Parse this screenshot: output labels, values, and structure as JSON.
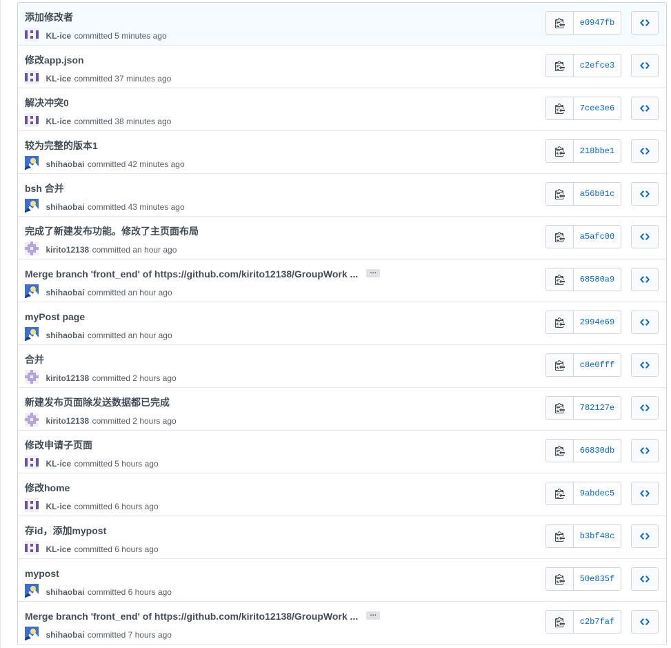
{
  "colors": {
    "link": "#0366d6",
    "text": "#444d56",
    "muted": "#586069",
    "border": "#d1d5da",
    "highlight": "#f6fbff"
  },
  "commits": [
    {
      "message": "添加修改者",
      "author": "KL-ice",
      "time": "committed 5 minutes ago",
      "sha": "e0947fb",
      "avatar": "kl-ice-avatar",
      "truncated": false
    },
    {
      "message": "修改app.json",
      "author": "KL-ice",
      "time": "committed 37 minutes ago",
      "sha": "c2efce3",
      "avatar": "kl-ice-avatar",
      "truncated": false
    },
    {
      "message": "解决冲突0",
      "author": "KL-ice",
      "time": "committed 38 minutes ago",
      "sha": "7cee3e6",
      "avatar": "kl-ice-avatar",
      "truncated": false
    },
    {
      "message": "较为完整的版本1",
      "author": "shihaobai",
      "time": "committed 42 minutes ago",
      "sha": "218bbe1",
      "avatar": "shihaobai-avatar",
      "truncated": false
    },
    {
      "message": "bsh 合并",
      "author": "shihaobai",
      "time": "committed 43 minutes ago",
      "sha": "a56b01c",
      "avatar": "shihaobai-avatar",
      "truncated": false
    },
    {
      "message": "完成了新建发布功能。修改了主页面布局",
      "author": "kirito12138",
      "time": "committed an hour ago",
      "sha": "a5afc00",
      "avatar": "kirito-avatar",
      "truncated": false
    },
    {
      "message": "Merge branch 'front_end' of https://github.com/kirito12138/GroupWork ...",
      "author": "shihaobai",
      "time": "committed an hour ago",
      "sha": "68580a9",
      "avatar": "shihaobai-avatar",
      "truncated": true
    },
    {
      "message": "myPost page",
      "author": "shihaobai",
      "time": "committed an hour ago",
      "sha": "2994e69",
      "avatar": "shihaobai-avatar",
      "truncated": false
    },
    {
      "message": "合并",
      "author": "kirito12138",
      "time": "committed 2 hours ago",
      "sha": "c8e0fff",
      "avatar": "kirito-avatar",
      "truncated": false
    },
    {
      "message": "新建发布页面除发送数据都已完成",
      "author": "kirito12138",
      "time": "committed 2 hours ago",
      "sha": "782127e",
      "avatar": "kirito-avatar",
      "truncated": false
    },
    {
      "message": "修改申请子页面",
      "author": "KL-ice",
      "time": "committed 5 hours ago",
      "sha": "66830db",
      "avatar": "kl-ice-avatar",
      "truncated": false
    },
    {
      "message": "修改home",
      "author": "KL-ice",
      "time": "committed 6 hours ago",
      "sha": "9abdec5",
      "avatar": "kl-ice-avatar",
      "truncated": false
    },
    {
      "message": "存id，添加mypost",
      "author": "KL-ice",
      "time": "committed 6 hours ago",
      "sha": "b3bf48c",
      "avatar": "kl-ice-avatar",
      "truncated": false
    },
    {
      "message": "mypost",
      "author": "shihaobai",
      "time": "committed 6 hours ago",
      "sha": "50e835f",
      "avatar": "shihaobai-avatar",
      "truncated": false
    },
    {
      "message": "Merge branch 'front_end' of https://github.com/kirito12138/GroupWork ...",
      "author": "shihaobai",
      "time": "committed 7 hours ago",
      "sha": "c2b7faf",
      "avatar": "shihaobai-avatar",
      "truncated": true
    }
  ],
  "ellipsis_label": "…",
  "icons": {
    "copy": "clipboard-icon",
    "browse": "code-icon"
  }
}
